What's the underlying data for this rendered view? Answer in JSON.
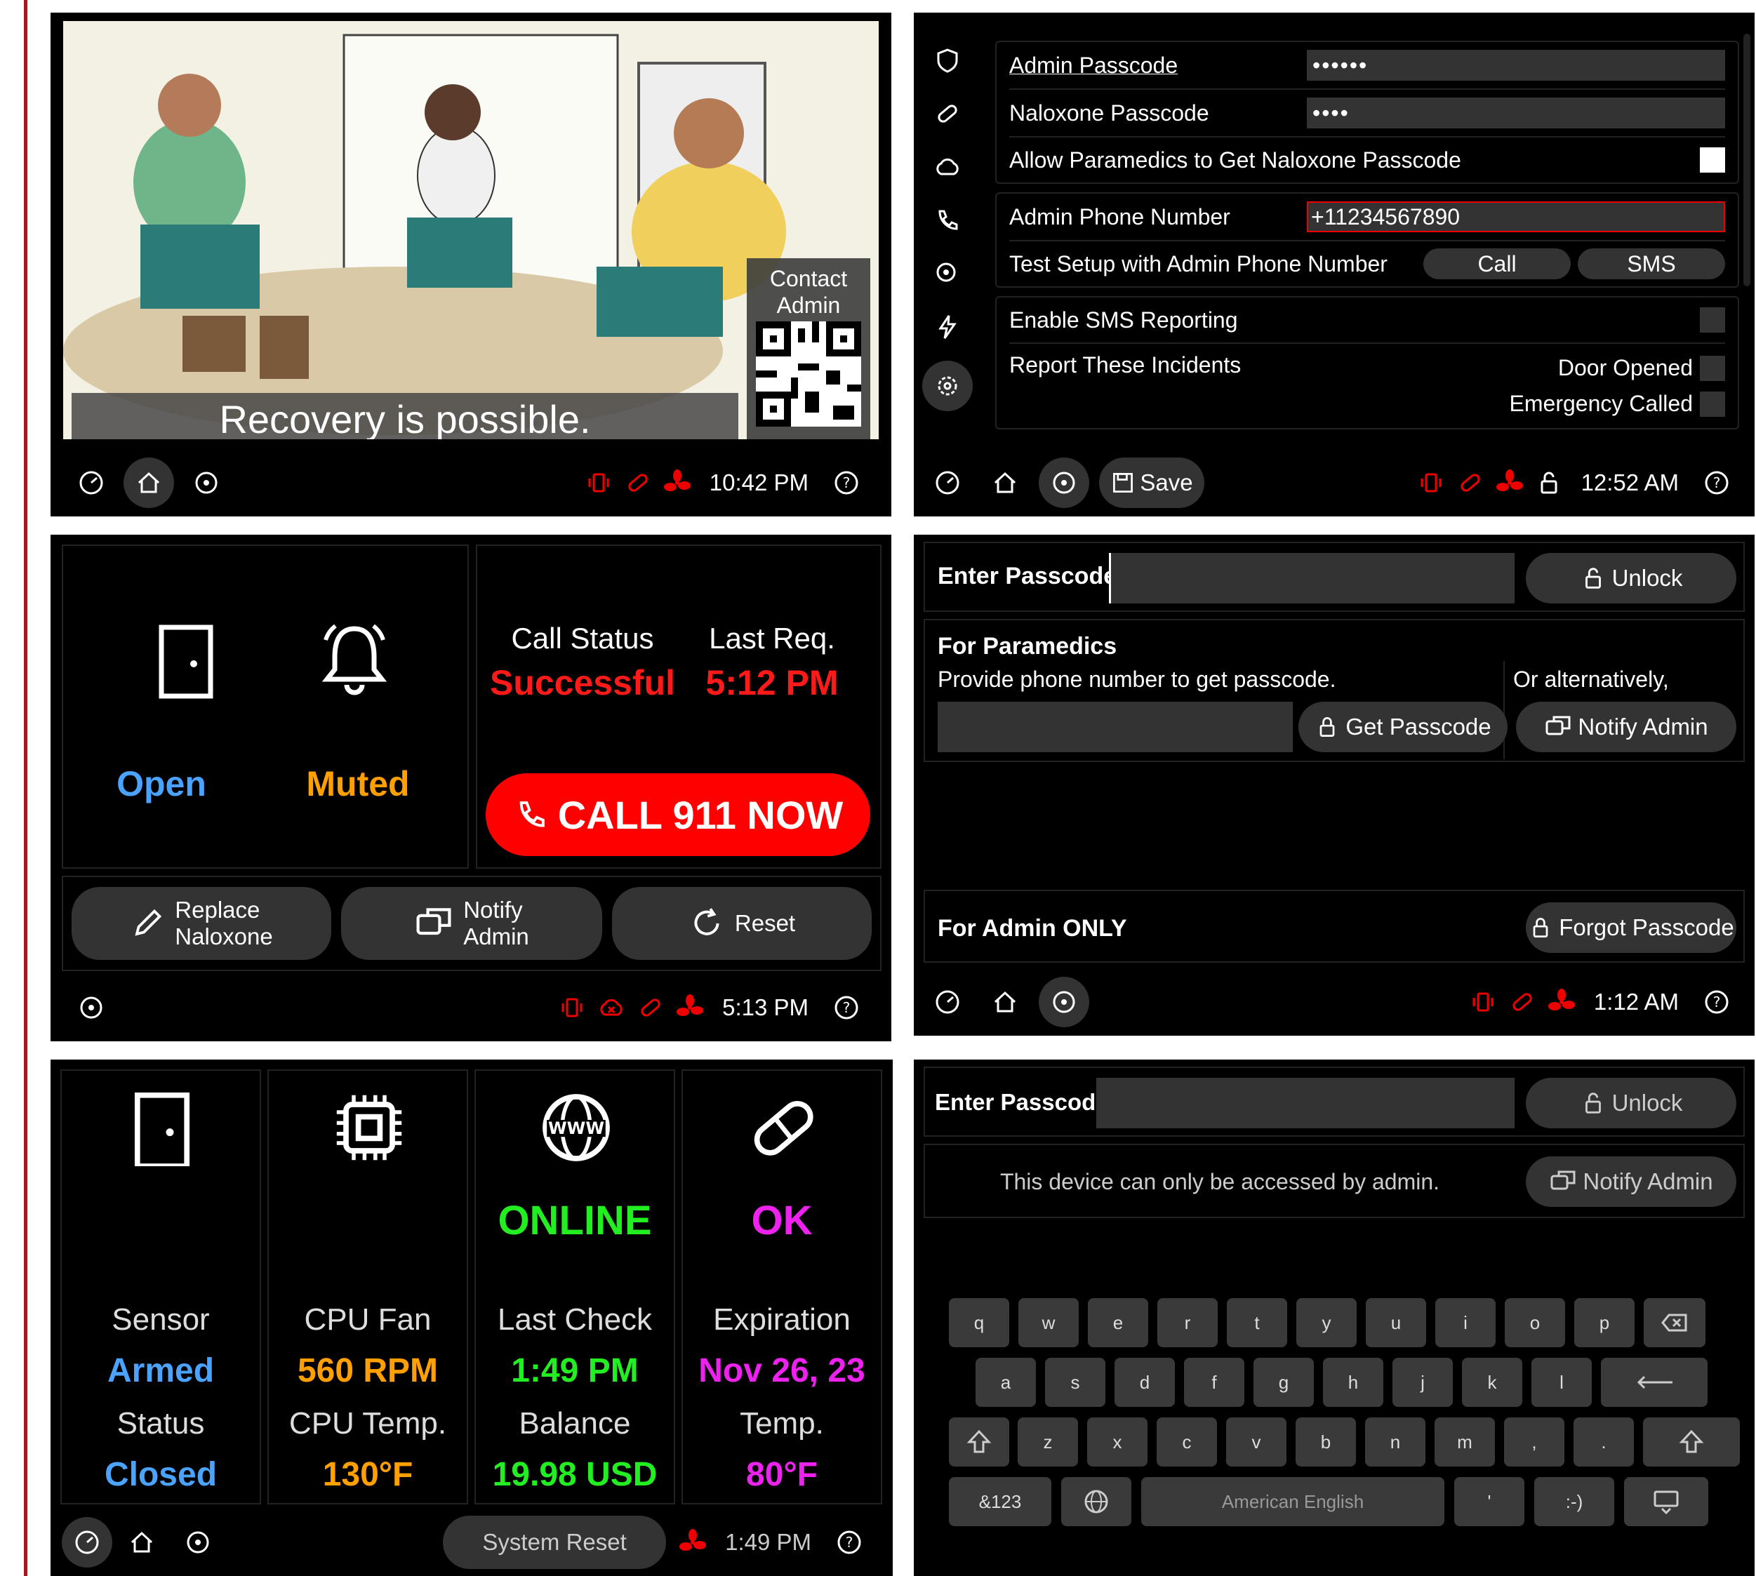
{
  "p1": {
    "overlay_text": "Recovery is possible.",
    "contact_label": "Contact\nAdmin",
    "time": "10:42 PM"
  },
  "p2": {
    "rows": {
      "admin_pass_label": "Admin Passcode",
      "admin_pass_value": "••••••",
      "nalox_pass_label": "Naloxone Passcode",
      "nalox_pass_value": "••••",
      "allow_label": "Allow Paramedics to Get Naloxone Passcode",
      "phone_label": "Admin Phone Number",
      "phone_value": "+11234567890",
      "test_label": "Test Setup with Admin Phone Number",
      "call": "Call",
      "sms": "SMS",
      "enable_sms": "Enable SMS Reporting",
      "report_label": "Report These Incidents",
      "door_opened": "Door Opened",
      "emergency_called": "Emergency Called"
    },
    "save": "Save",
    "time": "12:52 AM"
  },
  "p3": {
    "door_status": "Open",
    "alarm_status": "Muted",
    "call_status_label": "Call Status",
    "call_status_value": "Successful",
    "last_req_label": "Last Req.",
    "last_req_value": "5:12 PM",
    "call_btn": "CALL 911 NOW",
    "replace_btn": "Replace\nNaloxone",
    "notify_btn": "Notify\nAdmin",
    "reset_btn": "Reset",
    "time": "5:13 PM"
  },
  "p4": {
    "enter_label": "Enter Passcode",
    "unlock": "Unlock",
    "paramedics_title": "For Paramedics",
    "paramedics_desc": "Provide phone number to get passcode.",
    "or_alt": "Or alternatively,",
    "get_passcode": "Get Passcode",
    "notify_admin": "Notify Admin",
    "admin_only": "For Admin ONLY",
    "forgot": "Forgot Passcode",
    "time": "1:12 AM"
  },
  "p5": {
    "cols": [
      {
        "big": "",
        "l1": "Sensor",
        "v1": "Armed",
        "l2": "Status",
        "v2": "Closed",
        "color": "#4aa3ff"
      },
      {
        "big": "",
        "l1": "CPU Fan",
        "v1": "560 RPM",
        "l2": "CPU Temp.",
        "v2": "130°F",
        "color": "#ffa000"
      },
      {
        "big": "ONLINE",
        "l1": "Last Check",
        "v1": "1:49 PM",
        "l2": "Balance",
        "v2": "19.98 USD",
        "color": "#22ee22"
      },
      {
        "big": "OK",
        "l1": "Expiration",
        "v1": "Nov 26, 23",
        "l2": "Temp.",
        "v2": "80°F",
        "color": "#ee22ee"
      }
    ],
    "system_reset": "System Reset",
    "time": "1:49 PM"
  },
  "p6": {
    "enter_label": "Enter Passcode",
    "unlock": "Unlock",
    "message": "This device can only be accessed by admin.",
    "notify_admin": "Notify Admin",
    "keys_row1": [
      "q",
      "w",
      "e",
      "r",
      "t",
      "y",
      "u",
      "i",
      "o",
      "p"
    ],
    "keys_row2": [
      "a",
      "s",
      "d",
      "f",
      "g",
      "h",
      "j",
      "k",
      "l"
    ],
    "keys_row3": [
      "z",
      "x",
      "c",
      "v",
      "b",
      "n",
      "m",
      ",",
      "."
    ],
    "sym": "&123",
    "space": "American English",
    "apos": "'",
    "smile": ":-)"
  }
}
